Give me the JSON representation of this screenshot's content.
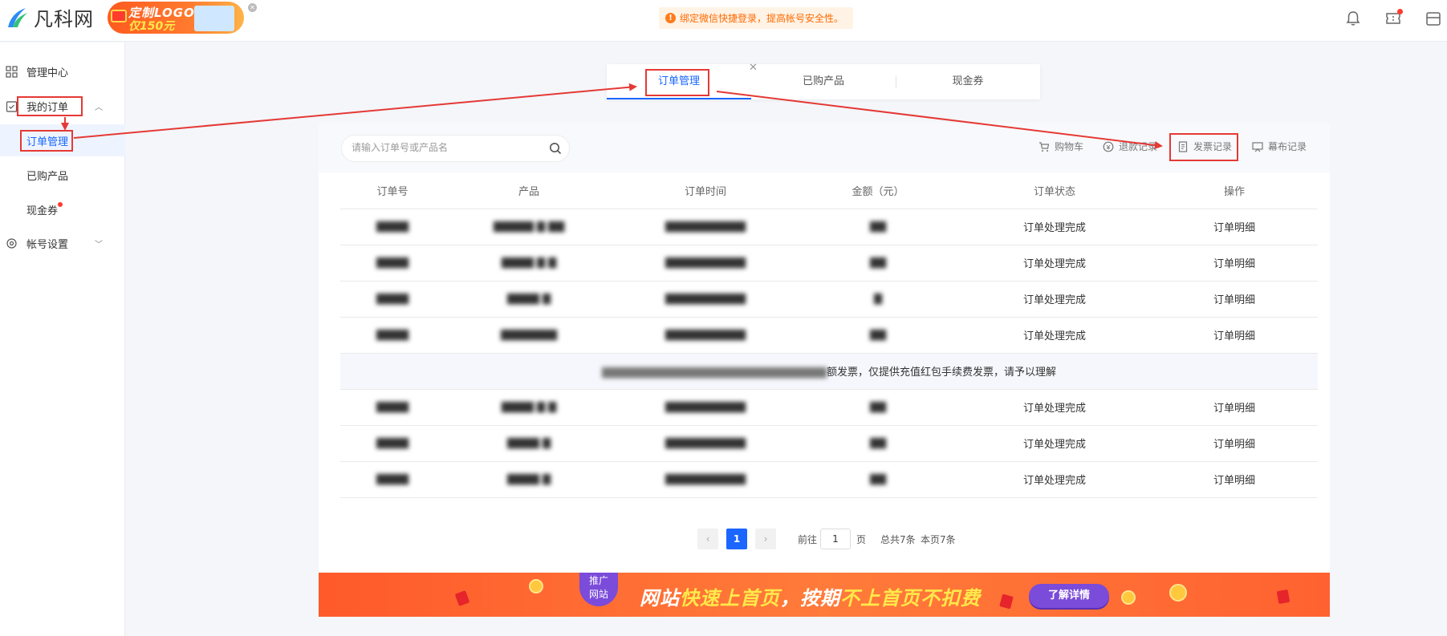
{
  "header": {
    "logo_text": "凡科网",
    "promo": {
      "line1": "定制LOGO",
      "line2": "仅150元"
    },
    "notice": "绑定微信快捷登录，提高帐号安全性。",
    "icons": [
      "bell-icon",
      "ticket-icon",
      "shop-icon"
    ]
  },
  "sidebar": {
    "items": [
      {
        "label": "管理中心"
      },
      {
        "label": "我的订单"
      },
      {
        "label": "帐号设置"
      }
    ],
    "sub": [
      {
        "label": "订单管理"
      },
      {
        "label": "已购产品"
      },
      {
        "label": "现金券"
      }
    ]
  },
  "tabs": [
    {
      "label": "订单管理"
    },
    {
      "label": "已购产品"
    },
    {
      "label": "现金券"
    }
  ],
  "search": {
    "placeholder": "请输入订单号或产品名"
  },
  "tools": [
    {
      "label": "购物车",
      "icon": "cart-icon"
    },
    {
      "label": "退款记录",
      "icon": "refund-icon"
    },
    {
      "label": "发票记录",
      "icon": "invoice-icon"
    },
    {
      "label": "幕布记录",
      "icon": "board-icon"
    }
  ],
  "table": {
    "headers": [
      "订单号",
      "产品",
      "订单时间",
      "金额（元）",
      "订单状态",
      "操作"
    ],
    "rows_before": [
      {
        "status": "订单处理完成",
        "action": "订单明细"
      },
      {
        "status": "订单处理完成",
        "action": "订单明细"
      },
      {
        "status": "订单处理完成",
        "action": "订单明细"
      },
      {
        "status": "订单处理完成",
        "action": "订单明细"
      }
    ],
    "notice": "额发票，仅提供充值红包手续费发票，请予以理解",
    "rows_after": [
      {
        "status": "订单处理完成",
        "action": "订单明细"
      },
      {
        "status": "订单处理完成",
        "action": "订单明细"
      },
      {
        "status": "订单处理完成",
        "action": "订单明细"
      }
    ]
  },
  "pager": {
    "current": "1",
    "goto_label": "前往",
    "page_value": "1",
    "page_unit": "页",
    "total": "总共7条",
    "this_page": "本页7条"
  },
  "banner": {
    "tag_line1": "推广",
    "tag_line2": "网站",
    "text_a": "网站",
    "text_b": "快速上首页",
    "text_c": "，按期",
    "text_d": "不上首页不扣费",
    "button": "了解详情"
  },
  "colors": {
    "accent": "#1a66ff",
    "annotation": "#e53935",
    "notice": "#ff6a00"
  }
}
